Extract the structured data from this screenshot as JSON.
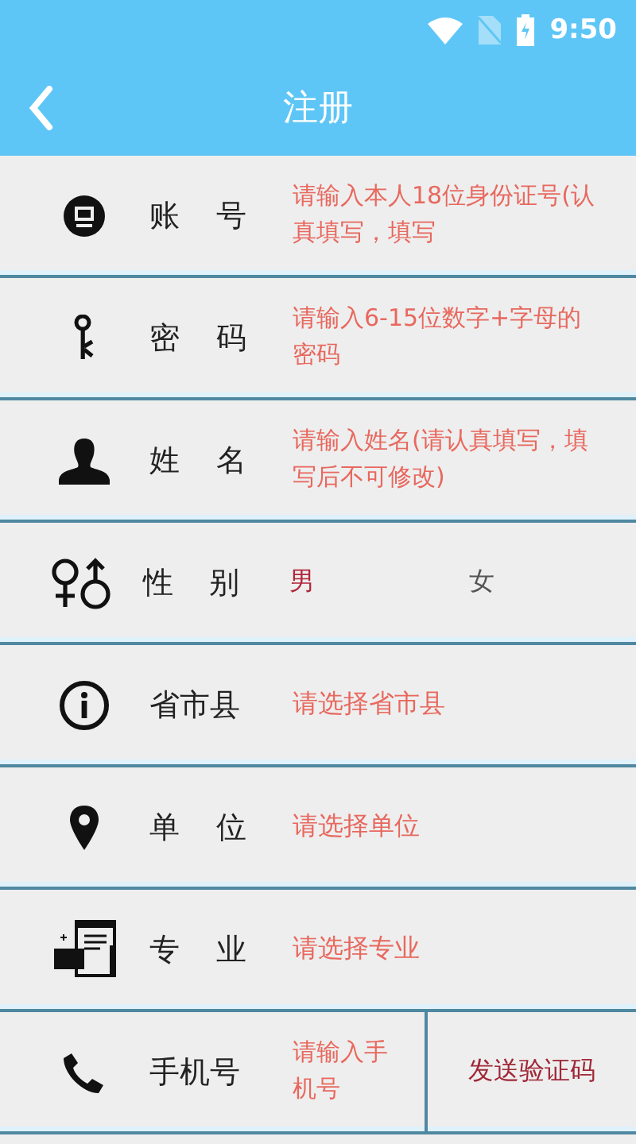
{
  "status_bar": {
    "time": "9:50"
  },
  "header": {
    "title": "注册"
  },
  "rows": [
    {
      "kind": "input",
      "label": "账号",
      "placeholder": "请输入本人18位身份证号(认真填写，填写"
    },
    {
      "kind": "input",
      "label": "密码",
      "placeholder": "请输入6-15位数字+字母的密码"
    },
    {
      "kind": "input",
      "label": "姓名",
      "placeholder": "请输入姓名(请认真填写，填写后不可修改)"
    },
    {
      "kind": "gender",
      "label": "性别",
      "options": [
        {
          "label": "男",
          "selected": true
        },
        {
          "label": "女",
          "selected": false
        }
      ]
    },
    {
      "kind": "select",
      "label": "省市县",
      "prompt": "请选择省市县"
    },
    {
      "kind": "select",
      "label": "单位",
      "prompt": "请选择单位"
    },
    {
      "kind": "select",
      "label": "专业",
      "prompt": "请选择专业"
    },
    {
      "kind": "phone",
      "label": "手机号",
      "placeholder": "请输入手机号",
      "button": "发送验证码"
    }
  ]
}
